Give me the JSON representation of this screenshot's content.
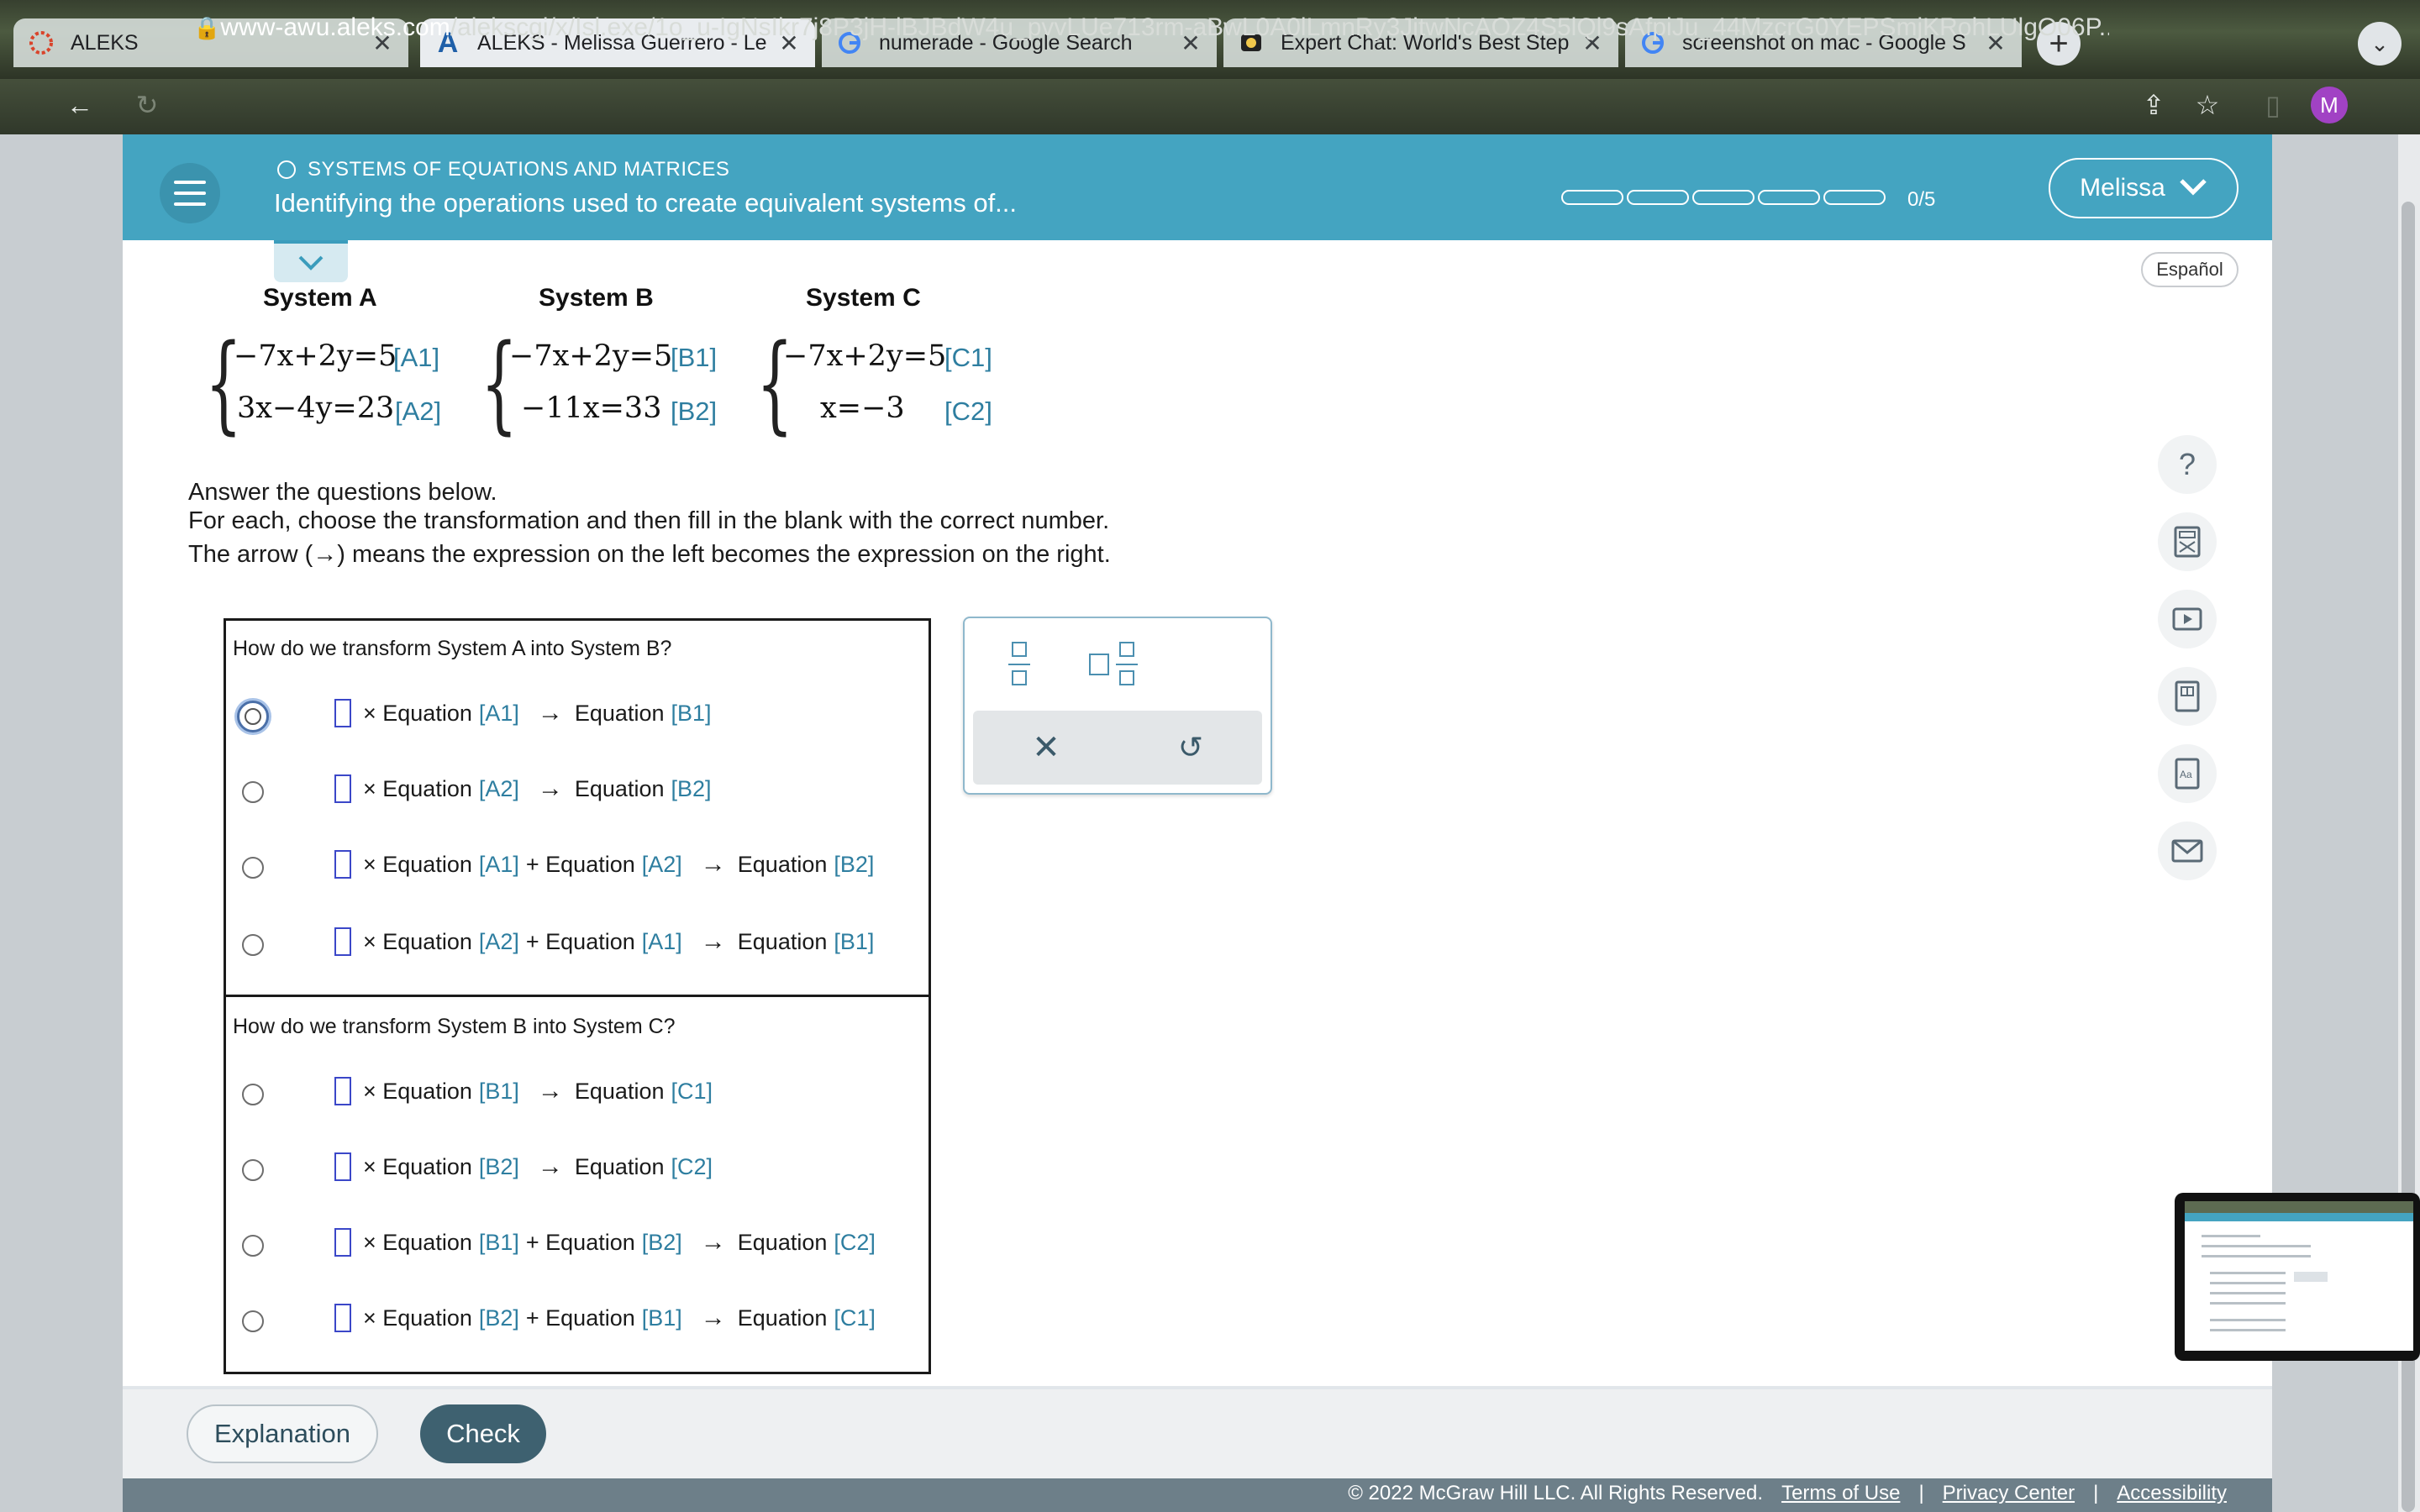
{
  "browser": {
    "tabs": [
      {
        "title": "ALEKS",
        "icon": "aleks-favicon"
      },
      {
        "title": "ALEKS - Melissa Guerrero - Le",
        "icon": "aleks-a-favicon"
      },
      {
        "title": "numerade - Google Search",
        "icon": "google-favicon"
      },
      {
        "title": "Expert Chat: World's Best Step",
        "icon": "chat-favicon"
      },
      {
        "title": "screenshot on mac - Google S",
        "icon": "google-favicon"
      }
    ],
    "url_domain": "www-awu.aleks.com",
    "url_path": "/alekscgi/x/Isl.exe/1o_u-IgNsIkr7j8P3jH-lBJBdW4u_pvvLUe713rm-aBwL0A0lLmnRy3JitwNcAOZ4S5lQl9sAfpiJu_44MzcrG0YEPSmjKRohLUlgO06P...",
    "profile_initial": "M"
  },
  "header": {
    "topic": "SYSTEMS OF EQUATIONS AND MATRICES",
    "title": "Identifying the operations used to create equivalent systems of...",
    "progress_count": "0/5",
    "progress_fraction": 0,
    "user_name": "Melissa",
    "language_link": "Español"
  },
  "systems": [
    {
      "title": "System A",
      "equations": [
        {
          "text": "−7x+2y=5",
          "label": "[A1]"
        },
        {
          "text": "3x−4y=23",
          "label": "[A2]"
        }
      ]
    },
    {
      "title": "System B",
      "equations": [
        {
          "text": "−7x+2y=5",
          "label": "[B1]"
        },
        {
          "text": "−11x=33",
          "label": "[B2]"
        }
      ]
    },
    {
      "title": "System C",
      "equations": [
        {
          "text": "−7x+2y=5",
          "label": "[C1]"
        },
        {
          "text": "x=−3",
          "label": "[C2]"
        }
      ]
    }
  ],
  "instructions": {
    "line1": "Answer the questions below.",
    "line2": "For each, choose the transformation and then fill in the blank with the correct number.",
    "line3_before": "The arrow",
    "line3_arrow": "(→)",
    "line3_after": "means the expression on the left becomes the expression on the right."
  },
  "questions": [
    {
      "prompt": "How do we transform System A into System B?",
      "options": [
        {
          "parts": [
            "× Equation",
            "[A1]",
            "→",
            "Equation",
            "[B1]"
          ]
        },
        {
          "parts": [
            "× Equation",
            "[A2]",
            "→",
            "Equation",
            "[B2]"
          ]
        },
        {
          "parts": [
            "× Equation",
            "[A1]",
            "+ Equation",
            "[A2]",
            "→",
            "Equation",
            "[B2]"
          ]
        },
        {
          "parts": [
            "× Equation",
            "[A2]",
            "+ Equation",
            "[A1]",
            "→",
            "Equation",
            "[B1]"
          ]
        }
      ]
    },
    {
      "prompt": "How do we transform System B into System C?",
      "options": [
        {
          "parts": [
            "× Equation",
            "[B1]",
            "→",
            "Equation",
            "[C1]"
          ]
        },
        {
          "parts": [
            "× Equation",
            "[B2]",
            "→",
            "Equation",
            "[C2]"
          ]
        },
        {
          "parts": [
            "× Equation",
            "[B1]",
            "+ Equation",
            "[B2]",
            "→",
            "Equation",
            "[C2]"
          ]
        },
        {
          "parts": [
            "× Equation",
            "[B2]",
            "+ Equation",
            "[B1]",
            "→",
            "Equation",
            "[C1]"
          ]
        }
      ]
    }
  ],
  "keypad": {
    "clear_symbol": "✕",
    "undo_symbol": "↺"
  },
  "side_tools": [
    "help-icon",
    "calculator-icon",
    "video-icon",
    "ebook-icon",
    "dictionary-icon",
    "mail-icon"
  ],
  "footer": {
    "explanation_label": "Explanation",
    "check_label": "Check",
    "copyright": "© 2022 McGraw Hill LLC. All Rights Reserved.",
    "links": [
      "Terms of Use",
      "Privacy Center",
      "Accessibility"
    ],
    "separator": "|"
  },
  "colors": {
    "header_bg": "#44a4c1",
    "equation_label": "#2e7ea0",
    "check_button": "#3e6170",
    "blank_border": "#3b47c8"
  }
}
